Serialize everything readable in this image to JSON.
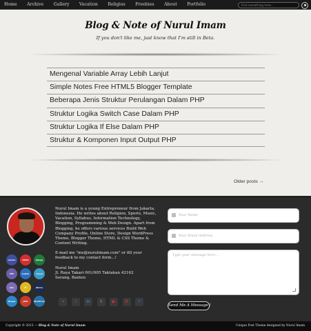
{
  "nav": {
    "items": [
      "Home",
      "Archive",
      "Gallery",
      "Vacation",
      "Religius",
      "Freebies",
      "About",
      "Portfolio"
    ],
    "search_placeholder": "Find something here..."
  },
  "header": {
    "title": "Blog & Note of Nurul Imam",
    "description": "If you don't like me, just know that I'm still in Beta."
  },
  "posts": [
    "Mengenal Variable Array Lebih Lanjut",
    "Simple Notes Free HTML5 Blogger Template",
    "Beberapa Jenis Struktur Perulangan Dalam PHP",
    "Struktur Logika Switch Case Dalam PHP",
    "Struktur Logika If Else Dalam PHP",
    "Struktur & Komponen Input Output PHP"
  ],
  "older_posts": "Older posts →",
  "footer": {
    "bio": "Nurul Imam is a young Entrepreneur from Jakarta, Indonesia. He writes about Religion, Sports, Music, Vacation, Syllabus, Information Technology, Blogging, Programming & Web Design. Apart from Blogging, he offers various services Build Web Company Profile, Online Store, Design WordPress Theme, Blogger Theme, HTML & CSS Theme & Content Writing.",
    "email_note": "E-mail me \"me@nurulimam.com\" or fill your feedback to my contact form...!",
    "address_name": "Nurul Imam",
    "address_line1": "Jl. Raya Takari 001/005 Taktakan 42162",
    "address_line2": "Serang, Banten",
    "badges": [
      {
        "label": "nmodo",
        "color": "#3f4fa0"
      },
      {
        "label": "DRILS",
        "color": "#d42f2f"
      },
      {
        "label": "django",
        "color": "#1f7a3a"
      },
      {
        "label": "PHP",
        "color": "#6b5ea8"
      },
      {
        "label": "mySQL",
        "color": "#2d6ec1"
      },
      {
        "label": "mysql",
        "color": "#3a9bc4"
      },
      {
        "label": "php",
        "color": "#7d6bb4"
      },
      {
        "label": "JS",
        "color": "#e2b823"
      },
      {
        "label": "jQuery",
        "color": "#1c2a50"
      },
      {
        "label": "Drupal",
        "color": "#2d86c9"
      },
      {
        "label": "JAVA",
        "color": "#c93a2a"
      },
      {
        "label": "WordPress",
        "color": "#2672a8"
      }
    ],
    "social": [
      {
        "icon": "rss-icon",
        "glyph": "◔",
        "color": "#e58b2f"
      },
      {
        "icon": "facebook-icon",
        "glyph": "f",
        "color": "#3a5a98"
      },
      {
        "icon": "linkedin-icon",
        "glyph": "in",
        "color": "#2f7fb0"
      },
      {
        "icon": "twitter-icon",
        "glyph": "t",
        "color": "#43a9d6"
      },
      {
        "icon": "youtube-icon",
        "glyph": "▶",
        "color": "#c8312a"
      },
      {
        "icon": "google-plus-icon",
        "glyph": "G",
        "color": "#c8392a"
      },
      {
        "icon": "paypal-icon",
        "glyph": "P",
        "color": "#2d5b9c"
      }
    ]
  },
  "form": {
    "name_placeholder": "Your Name",
    "email_placeholder": "Your Email Address",
    "message_placeholder": "Type your message here...",
    "send_label": "Send Me A Message !"
  },
  "bottom": {
    "copyright_prefix": "Copyright © 2013 — ",
    "copyright_site": "Blog & Note of Nurul Imam",
    "credit": "Unique Post Theme designed by Nurul Imam"
  }
}
